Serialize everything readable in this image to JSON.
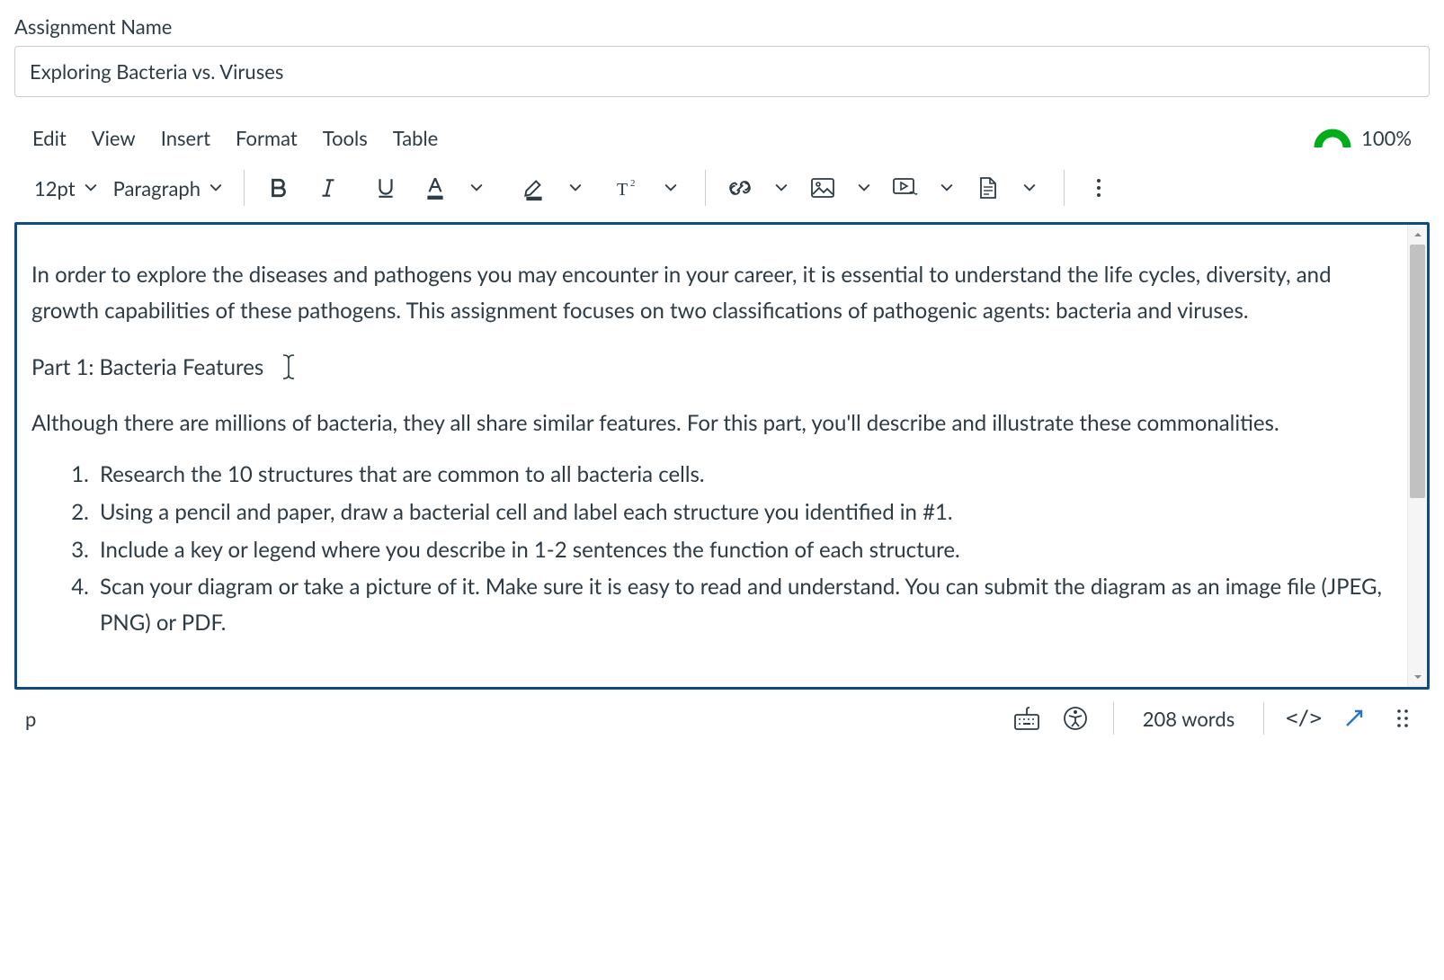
{
  "field_label": "Assignment Name",
  "assignment_name": "Exploring Bacteria vs. Viruses",
  "menubar": {
    "edit": "Edit",
    "view": "View",
    "insert": "Insert",
    "format": "Format",
    "tools": "Tools",
    "table": "Table"
  },
  "a11y_percent": "100%",
  "toolbar": {
    "font_size": "12pt",
    "block_format": "Paragraph"
  },
  "content": {
    "p1": "In order to explore the diseases and pathogens you may encounter in your career, it is essential to understand the life cycles, diversity, and growth capabilities of these pathogens. This assignment focuses on two classifications of pathogenic agents: bacteria and viruses.",
    "p2": "Part 1: Bacteria Features",
    "p3": "Although there are millions of bacteria, they all share similar features. For this part, you'll describe and illustrate these commonalities.",
    "li1": "Research the 10 structures that are common to all bacteria cells.",
    "li2": "Using a pencil and paper, draw a bacterial cell and label each structure you identified in #1.",
    "li3": "Include a key or legend where you describe in 1-2 sentences the function of each structure.",
    "li4": "Scan your diagram or take a picture of it. Make sure it is easy to read and understand. You can submit the diagram as an image file (JPEG, PNG) or PDF."
  },
  "status": {
    "path": "p",
    "words": "208 words",
    "html": "</>"
  }
}
